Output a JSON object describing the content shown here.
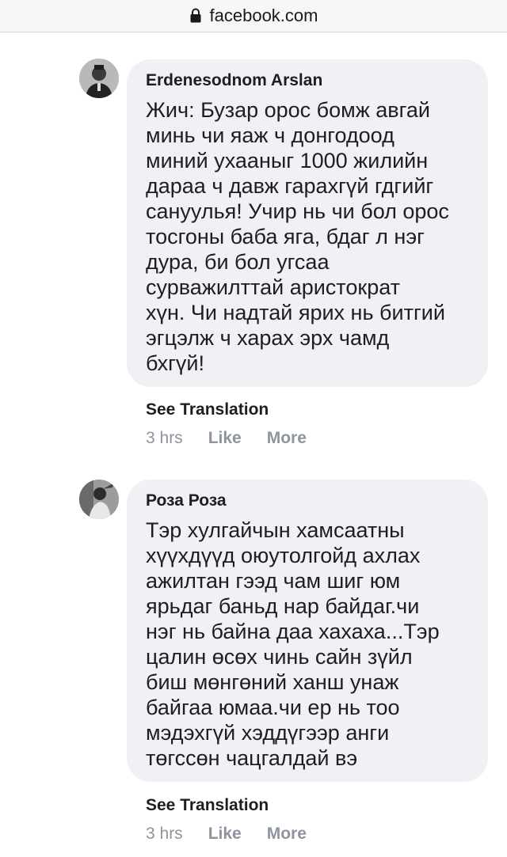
{
  "browser": {
    "url": "facebook.com",
    "lock_icon": "lock-icon"
  },
  "comments": [
    {
      "author": "Erdenesodnom Arslan",
      "text": "Жич: Бузар орос бомж авгай\nминь чи яаж ч донгодоод\nминий ухааныг 1000 жилийн\nдараа ч давж гарахгүй гдгийг\nсануулья! Учир нь чи бол орос\nтосгоны баба яга, бдаг л нэг\nдура, би бол угсаа\nсурважилттай аристократ\nхүн. Чи надтай ярих нь битгий\nэгцэлж ч харах эрх чамд\nбхгүй!",
      "see_translation": "See Translation",
      "time": "3 hrs",
      "like": "Like",
      "more": "More"
    },
    {
      "author": "Роза Роза",
      "text": "Тэр хулгайчын хамсаатны\nхүүхдүүд оюутолгойд ахлах\nажилтан гээд чам шиг юм\nярьдаг баньд нар байдаг.чи\nнэг нь байна даа хахаха...Тэр\nцалин өсөх чинь сайн зүйл\nбиш мөнгөний ханш унаж\nбайгаа юмаа.чи ер нь тоо\nмэдэхгүй хэддүгээр анги\nтөгссөн чацгалдай вэ",
      "see_translation": "See Translation",
      "time": "3 hrs",
      "like": "Like",
      "more": "More"
    }
  ],
  "colors": {
    "bubble_bg": "#f0f1f4",
    "meta_gray": "#8d949e",
    "text": "#1c1e21"
  }
}
